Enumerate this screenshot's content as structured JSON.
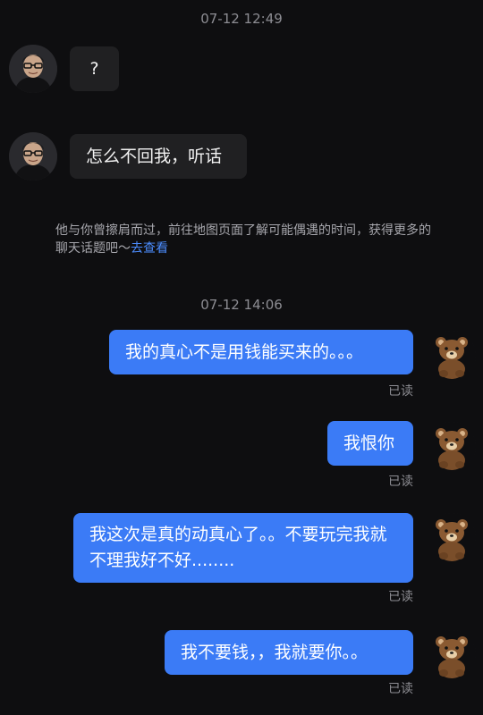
{
  "timestamps": {
    "first": "07-12 12:49",
    "second": "07-12 14:06"
  },
  "incoming": [
    {
      "text": "?"
    },
    {
      "text": "怎么不回我，听话"
    }
  ],
  "notice": {
    "text": "他与你曾擦肩而过，前往地图页面了解可能偶遇的时间，获得更多的聊天话题吧～",
    "link": "去查看"
  },
  "outgoing": [
    {
      "text": "我的真心不是用钱能买来的。。。",
      "status": "已读"
    },
    {
      "text": "我恨你",
      "status": "已读"
    },
    {
      "text": "我这次是真的动真心了。。不要玩完我就不理我好不好........",
      "status": "已读"
    },
    {
      "text": "我不要钱，，我就要你。。",
      "status": "已读"
    }
  ],
  "colors": {
    "background": "#0e0e10",
    "outgoing_bubble": "#3b7bf6",
    "incoming_bubble": "#202022",
    "link": "#4c8dff"
  },
  "icons": {
    "contact_avatar": "man-with-glasses-avatar",
    "own_avatar": "teddy-bear-avatar"
  }
}
